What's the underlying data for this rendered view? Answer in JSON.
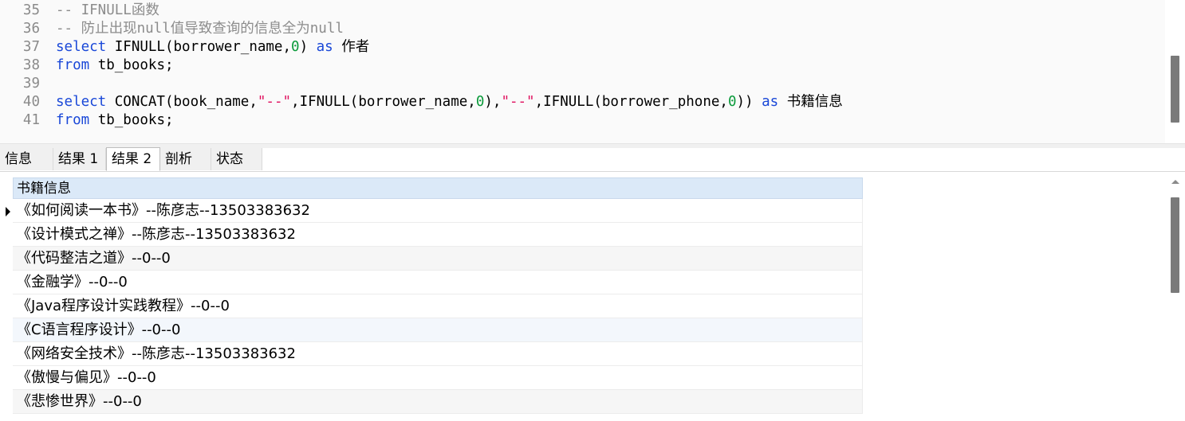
{
  "editor": {
    "lines": [
      {
        "num": "35",
        "tokens": [
          {
            "t": "cm",
            "v": "-- IFNULL函数"
          }
        ]
      },
      {
        "num": "36",
        "tokens": [
          {
            "t": "cm",
            "v": "-- 防止出现null值导致查询的信息全为null"
          }
        ]
      },
      {
        "num": "37",
        "tokens": [
          {
            "t": "kw",
            "v": "select"
          },
          {
            "t": "id",
            "v": " IFNULL(borrower_name,"
          },
          {
            "t": "num",
            "v": "0"
          },
          {
            "t": "id",
            "v": ") "
          },
          {
            "t": "kw",
            "v": "as"
          },
          {
            "t": "id",
            "v": " 作者"
          }
        ]
      },
      {
        "num": "38",
        "tokens": [
          {
            "t": "kw",
            "v": "from"
          },
          {
            "t": "id",
            "v": " tb_books;"
          }
        ]
      },
      {
        "num": "39",
        "tokens": []
      },
      {
        "num": "40",
        "tokens": [
          {
            "t": "kw",
            "v": "select"
          },
          {
            "t": "id",
            "v": " CONCAT(book_name,"
          },
          {
            "t": "str",
            "v": "\"--\""
          },
          {
            "t": "id",
            "v": ",IFNULL(borrower_name,"
          },
          {
            "t": "num",
            "v": "0"
          },
          {
            "t": "id",
            "v": "),"
          },
          {
            "t": "str",
            "v": "\"--\""
          },
          {
            "t": "id",
            "v": ",IFNULL(borrower_phone,"
          },
          {
            "t": "num",
            "v": "0"
          },
          {
            "t": "id",
            "v": ")) "
          },
          {
            "t": "kw",
            "v": "as"
          },
          {
            "t": "id",
            "v": " 书籍信息"
          }
        ]
      },
      {
        "num": "41",
        "tokens": [
          {
            "t": "kw",
            "v": "from"
          },
          {
            "t": "id",
            "v": " tb_books;"
          }
        ]
      }
    ]
  },
  "tabs": [
    {
      "label": "信息",
      "active": false
    },
    {
      "label": "结果 1",
      "active": false
    },
    {
      "label": "结果 2",
      "active": true
    },
    {
      "label": "剖析",
      "active": false
    },
    {
      "label": "状态",
      "active": false
    }
  ],
  "result": {
    "column": "书籍信息",
    "rows": [
      "《如何阅读一本书》--陈彦志--13503383632",
      "《设计模式之禅》--陈彦志--13503383632",
      "《代码整洁之道》--0--0",
      "《金融学》--0--0",
      "《Java程序设计实践教程》--0--0",
      "《C语言程序设计》--0--0",
      "《网络安全技术》--陈彦志--13503383632",
      "《傲慢与偏见》--0--0",
      "《悲惨世界》--0--0"
    ],
    "selected_row": 0
  },
  "colors": {
    "keyword": "#1a48d8",
    "comment": "#8c8c8c",
    "string": "#e0115f",
    "number": "#0a9a3a",
    "header_bg": "#dbe9f8"
  }
}
